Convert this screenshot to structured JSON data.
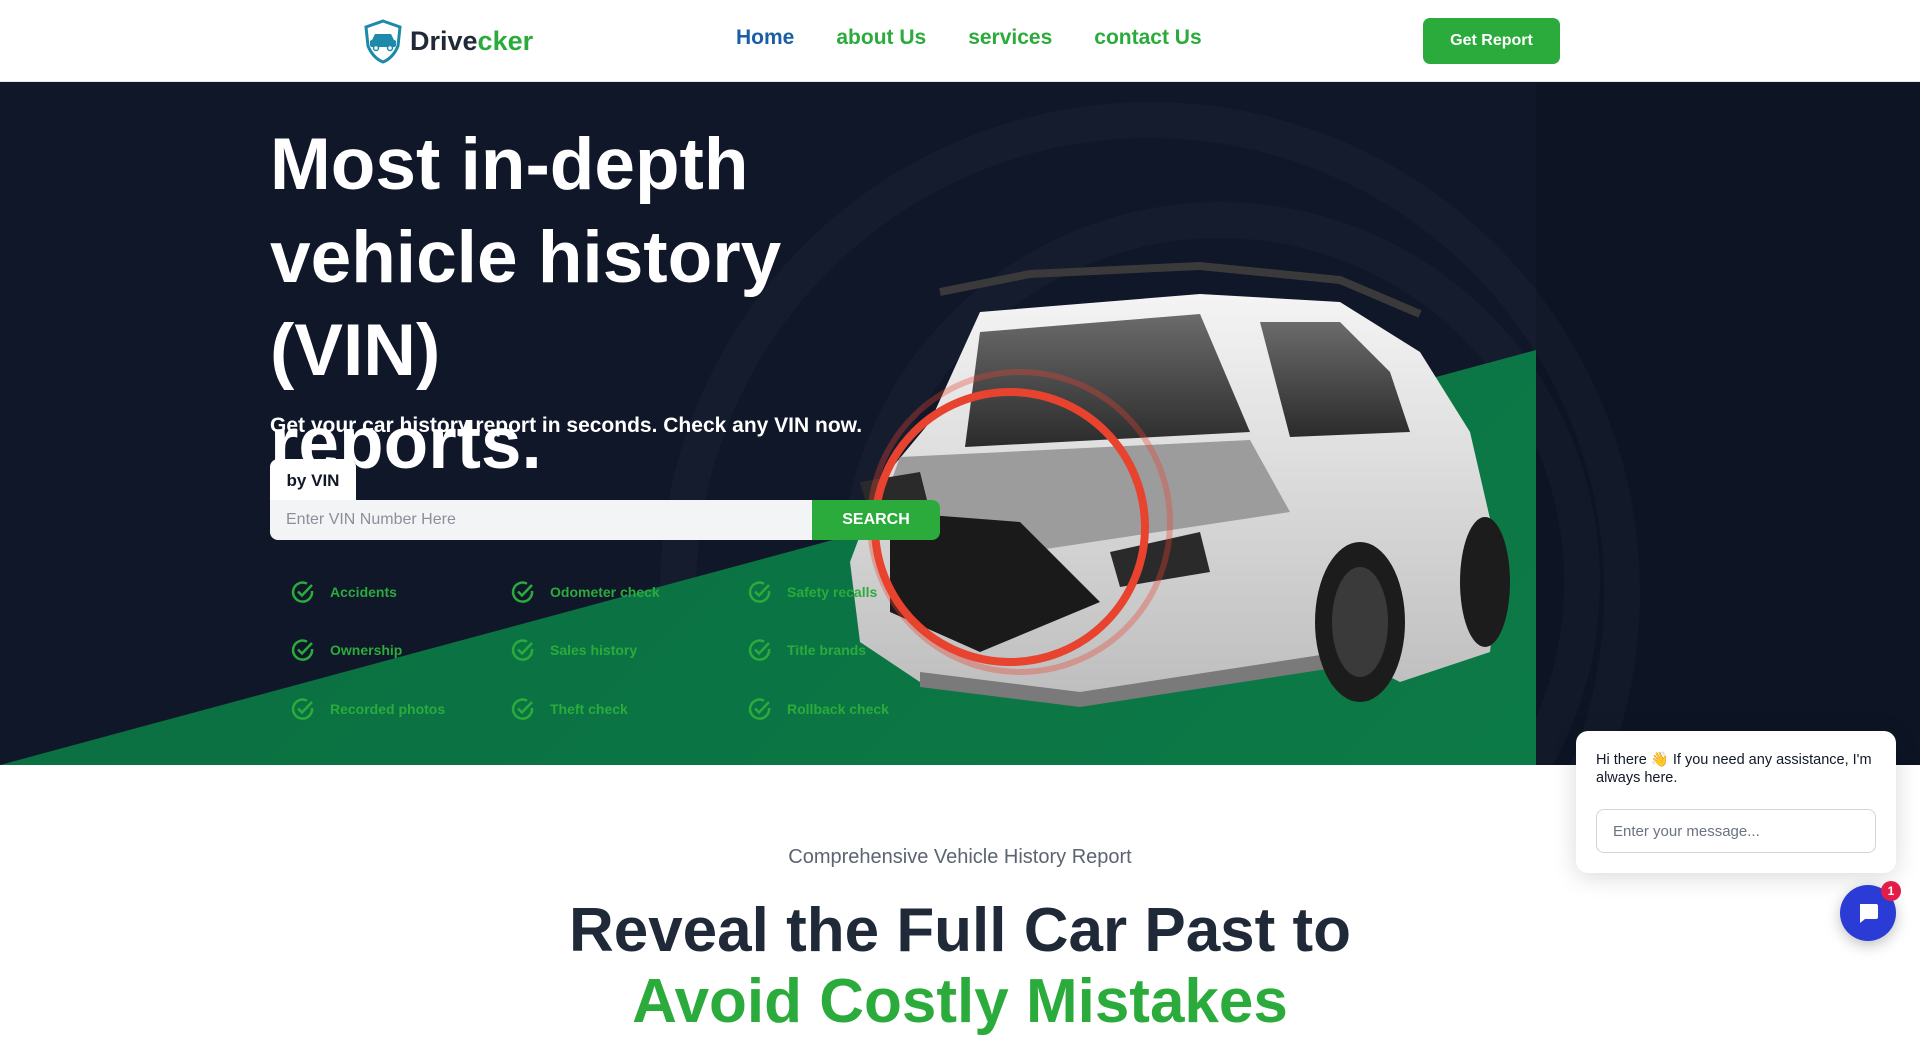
{
  "header": {
    "logo": {
      "part1": "Drive",
      "part2": "cker"
    },
    "nav": [
      {
        "label": "Home",
        "active": true
      },
      {
        "label": "about Us",
        "active": false
      },
      {
        "label": "services",
        "active": false
      },
      {
        "label": "contact Us",
        "active": false
      }
    ],
    "cta_label": "Get Report"
  },
  "hero": {
    "title_line1": "Most in-depth",
    "title_line2": "vehicle history (VIN)",
    "title_line3": "reports.",
    "subtitle": "Get your car history report in seconds. Check any VIN now.",
    "tab_label": "by VIN",
    "vin_placeholder": "Enter VIN Number Here",
    "search_label": "SEARCH",
    "features": [
      "Accidents",
      "Odometer check",
      "Safety recalls",
      "Ownership",
      "Sales history",
      "Title brands",
      "Recorded photos",
      "Theft check",
      "Rollback check"
    ]
  },
  "section": {
    "kicker": "Comprehensive Vehicle History Report",
    "title_line1": "Reveal the Full Car Past to",
    "title_line2": "Avoid Costly Mistakes"
  },
  "chat": {
    "message_part1": "Hi there",
    "message_emoji": "👋",
    "message_part2": "If you need any assistance, I'm always here.",
    "input_placeholder": "Enter your message...",
    "badge_count": "1"
  },
  "colors": {
    "brand_green": "#2bab3c",
    "nav_active_blue": "#1a5fa5",
    "hero_dark": "#0f1729",
    "hero_green": "#0c7a47",
    "chat_blue": "#2a3bd6",
    "badge_red": "#e11d48"
  }
}
